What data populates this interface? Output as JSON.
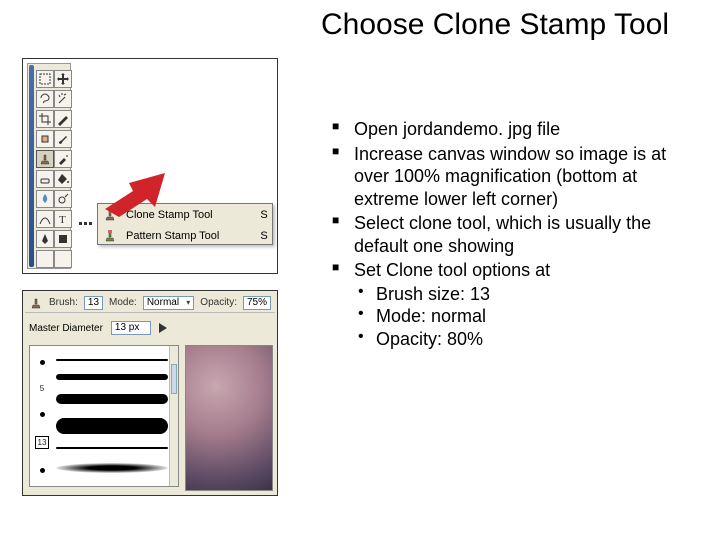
{
  "title": "Choose Clone Stamp Tool",
  "bullets": [
    {
      "text": "Open jordandemo. jpg file"
    },
    {
      "text": "Increase canvas window so image is at over 100% magnification (bottom at extreme lower left corner)"
    },
    {
      "text": "Select clone tool, which is usually the default one showing"
    },
    {
      "text": "Set Clone tool options at",
      "sub": [
        "Brush size: 13",
        "Mode: normal",
        "Opacity: 80%"
      ]
    }
  ],
  "flyout": {
    "row1": {
      "label": "Clone Stamp Tool",
      "key": "S"
    },
    "row2": {
      "label": "Pattern Stamp Tool",
      "key": "S"
    }
  },
  "optbar": {
    "brush_label": "Brush:",
    "brush_val": "13",
    "mode_label": "Mode:",
    "mode_val": "Normal",
    "opacity_label": "Opacity:",
    "opacity_val": "75%"
  },
  "brushrow": {
    "label": "Master Diameter",
    "value": "13 px"
  },
  "brush_sizes": [
    "5",
    "",
    "",
    "13",
    ""
  ]
}
